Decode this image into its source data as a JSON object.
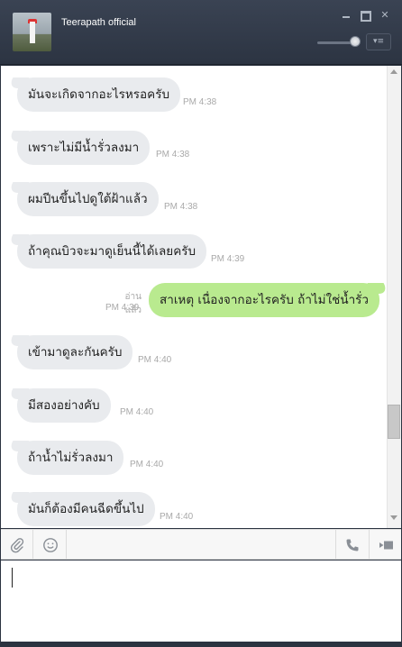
{
  "header": {
    "title": "Teerapath official",
    "avatar_icon": "lighthouse-photo",
    "window_controls": [
      "minimize-icon",
      "maximize-icon",
      "close-icon"
    ],
    "volume_level": 0.85,
    "menu_icon": "menu-dropdown-icon"
  },
  "messages": [
    {
      "side": "in",
      "text": "มันจะเกิดจากอะไรหรอครับ",
      "time": "PM 4:38"
    },
    {
      "side": "in",
      "text": "เพราะไม่มีน้ำรั่วลงมา",
      "time": "PM 4:38"
    },
    {
      "side": "in",
      "text": "ผมปีนขึ้นไปดูใต้ฝ้าแล้ว",
      "time": "PM 4:38"
    },
    {
      "side": "in",
      "text": "ถ้าคุณบิวจะมาดูเย็นนี้ได้เลยครับ",
      "time": "PM 4:39"
    },
    {
      "side": "out",
      "text": "สาเหตุ เนื่องจากอะไรครับ ถ้าไม่ใช่น้ำรั่ว",
      "time": "PM 4:39",
      "status": "อ่านแล้ว"
    },
    {
      "side": "in",
      "text": "เข้ามาดูละกันครับ",
      "time": "PM 4:40"
    },
    {
      "side": "in",
      "text": "มีสองอย่างคับ",
      "time": "PM 4:40"
    },
    {
      "side": "in",
      "text": "ถ้าน้ำไม่รั่วลงมา",
      "time": "PM 4:40"
    },
    {
      "side": "in",
      "text": "มันก็ต้องมีคนฉีดขึ้นไป",
      "time": "PM 4:40"
    }
  ],
  "toolbar": {
    "left": [
      "paperclip-icon",
      "emoji-icon"
    ],
    "right": [
      "phone-icon",
      "video-call-icon"
    ]
  },
  "input": {
    "value": ""
  },
  "colors": {
    "header": "#2c3442",
    "incoming_bubble": "#e9ebee",
    "outgoing_bubble": "#b9ea8f"
  }
}
